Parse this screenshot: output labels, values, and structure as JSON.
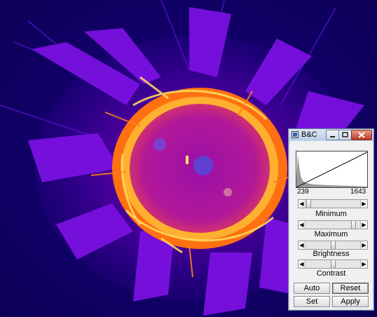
{
  "window": {
    "title": "B&C"
  },
  "histogram": {
    "min_value": "239",
    "max_value": "1643"
  },
  "sliders": [
    {
      "label": "Minimum",
      "level": 0.02
    },
    {
      "label": "Maximum",
      "level": 0.92
    },
    {
      "label": "Brightness",
      "level": 0.5
    },
    {
      "label": "Contrast",
      "level": 0.5
    }
  ],
  "buttons": {
    "auto": "Auto",
    "reset": "Reset",
    "set": "Set",
    "apply": "Apply"
  },
  "colors": {
    "lut_low": "#0a0050",
    "lut_mid": "#8a00c8",
    "lut_high": "#ffd040"
  }
}
